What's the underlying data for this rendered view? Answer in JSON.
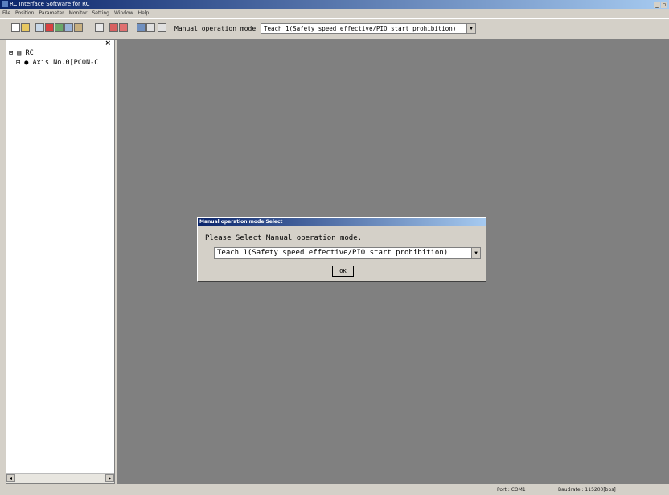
{
  "window": {
    "title": "RC Interface Software for RC"
  },
  "menu": [
    "File",
    "Position",
    "Parameter",
    "Monitor",
    "Setting",
    "Window",
    "Help"
  ],
  "toolbar": {
    "mode_label": "Manual operation mode",
    "mode_value": "Teach 1(Safety speed effective/PIO start prohibition)"
  },
  "tree": {
    "root": "RC",
    "child": "Axis No.0[PCON-C"
  },
  "dialog": {
    "title": "Manual operation mode Select",
    "prompt": "Please Select Manual operation mode.",
    "selected": "Teach 1(Safety speed effective/PIO start prohibition)",
    "ok_label": "OK"
  },
  "status": {
    "port": "Port : COM1",
    "baudrate": "Baudrate : 115200[bps]"
  }
}
